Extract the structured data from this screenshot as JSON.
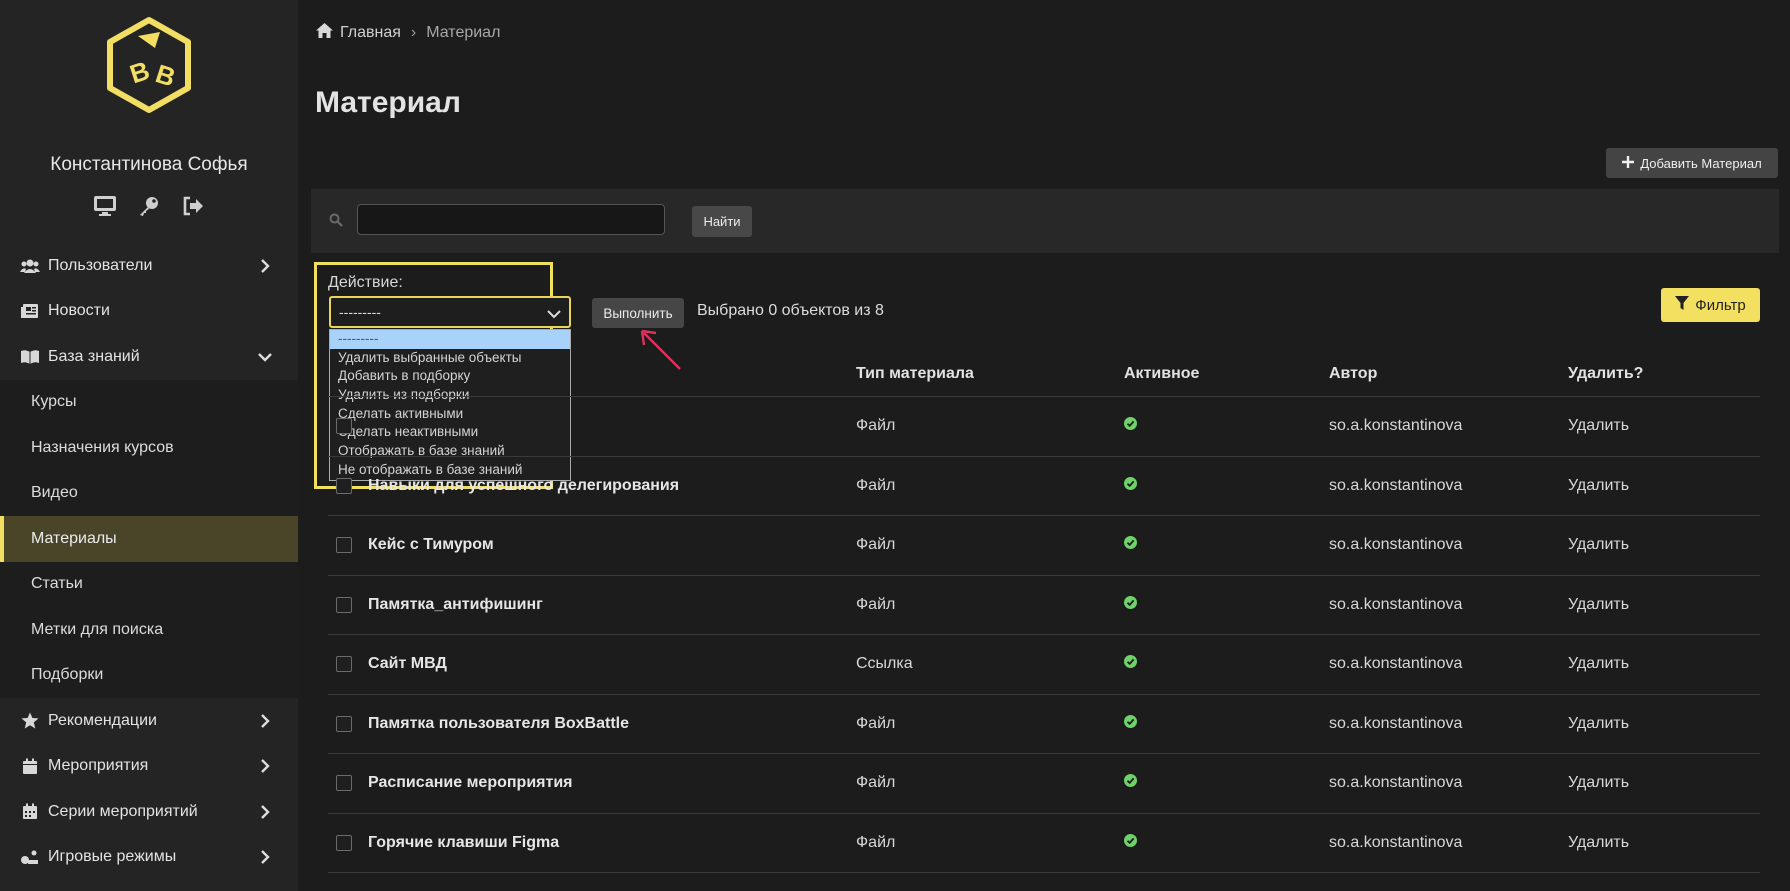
{
  "user": {
    "name": "Константинова Софья"
  },
  "icons": {
    "user_actions": [
      "monitor-icon",
      "key-icon",
      "logout-icon"
    ],
    "accent": "#f1de63",
    "active_check_color": "#6fd16a"
  },
  "nav": [
    {
      "label": "Пользователи",
      "icon": "users-icon",
      "chevron": "right"
    },
    {
      "label": "Новости",
      "icon": "newspaper-icon"
    },
    {
      "label": "База знаний",
      "icon": "book-icon",
      "chevron": "down"
    },
    {
      "label": "Курсы",
      "sub": true
    },
    {
      "label": "Назначения курсов",
      "sub": true
    },
    {
      "label": "Видео",
      "sub": true
    },
    {
      "label": "Материалы",
      "sub": true,
      "active": true
    },
    {
      "label": "Статьи",
      "sub": true
    },
    {
      "label": "Метки для поиска",
      "sub": true
    },
    {
      "label": "Подборки",
      "sub": true
    },
    {
      "label": "Рекомендации",
      "icon": "star-icon",
      "chevron": "right"
    },
    {
      "label": "Мероприятия",
      "icon": "calendar-icon",
      "chevron": "right"
    },
    {
      "label": "Серии мероприятий",
      "icon": "calendar-grid-icon",
      "chevron": "right"
    },
    {
      "label": "Игровые режимы",
      "icon": "gamepad-icon",
      "chevron": "right"
    }
  ],
  "breadcrumb": {
    "home": "Главная",
    "sep": "›",
    "current": "Материал"
  },
  "page": {
    "title": "Материал",
    "add_label": "Добавить Материал"
  },
  "search": {
    "value": "",
    "placeholder": "",
    "button": "Найти"
  },
  "actions": {
    "label": "Действие:",
    "selected": "---------",
    "options": [
      "---------",
      "Удалить выбранные объекты",
      "Добавить в подборку",
      "Удалить из подборки",
      "Сделать активными",
      "Сделать неактивными",
      "Отображать в базе знаний",
      "Не отображать в базе знаний"
    ],
    "run": "Выполнить",
    "counter": "Выбрано 0 объектов из 8"
  },
  "filter": {
    "label": "Фильтр"
  },
  "table": {
    "headers": [
      "Тип материала",
      "Активное",
      "Автор",
      "Удалить?"
    ],
    "rows": [
      {
        "name": "",
        "type": "Файл",
        "active": true,
        "author": "so.a.konstantinova",
        "delete": "Удалить"
      },
      {
        "name": "Навыки для успешного делегирования",
        "type": "Файл",
        "active": true,
        "author": "so.a.konstantinova",
        "delete": "Удалить"
      },
      {
        "name": "Кейс с Тимуром",
        "type": "Файл",
        "active": true,
        "author": "so.a.konstantinova",
        "delete": "Удалить"
      },
      {
        "name": "Памятка_антифишинг",
        "type": "Файл",
        "active": true,
        "author": "so.a.konstantinova",
        "delete": "Удалить"
      },
      {
        "name": "Сайт МВД",
        "type": "Ссылка",
        "active": true,
        "author": "so.a.konstantinova",
        "delete": "Удалить"
      },
      {
        "name": "Памятка пользователя BoxBattle",
        "type": "Файл",
        "active": true,
        "author": "so.a.konstantinova",
        "delete": "Удалить"
      },
      {
        "name": "Расписание мероприятия",
        "type": "Файл",
        "active": true,
        "author": "so.a.konstantinova",
        "delete": "Удалить"
      },
      {
        "name": "Горячие клавиши Figma",
        "type": "Файл",
        "active": true,
        "author": "so.a.konstantinova",
        "delete": "Удалить"
      }
    ]
  }
}
